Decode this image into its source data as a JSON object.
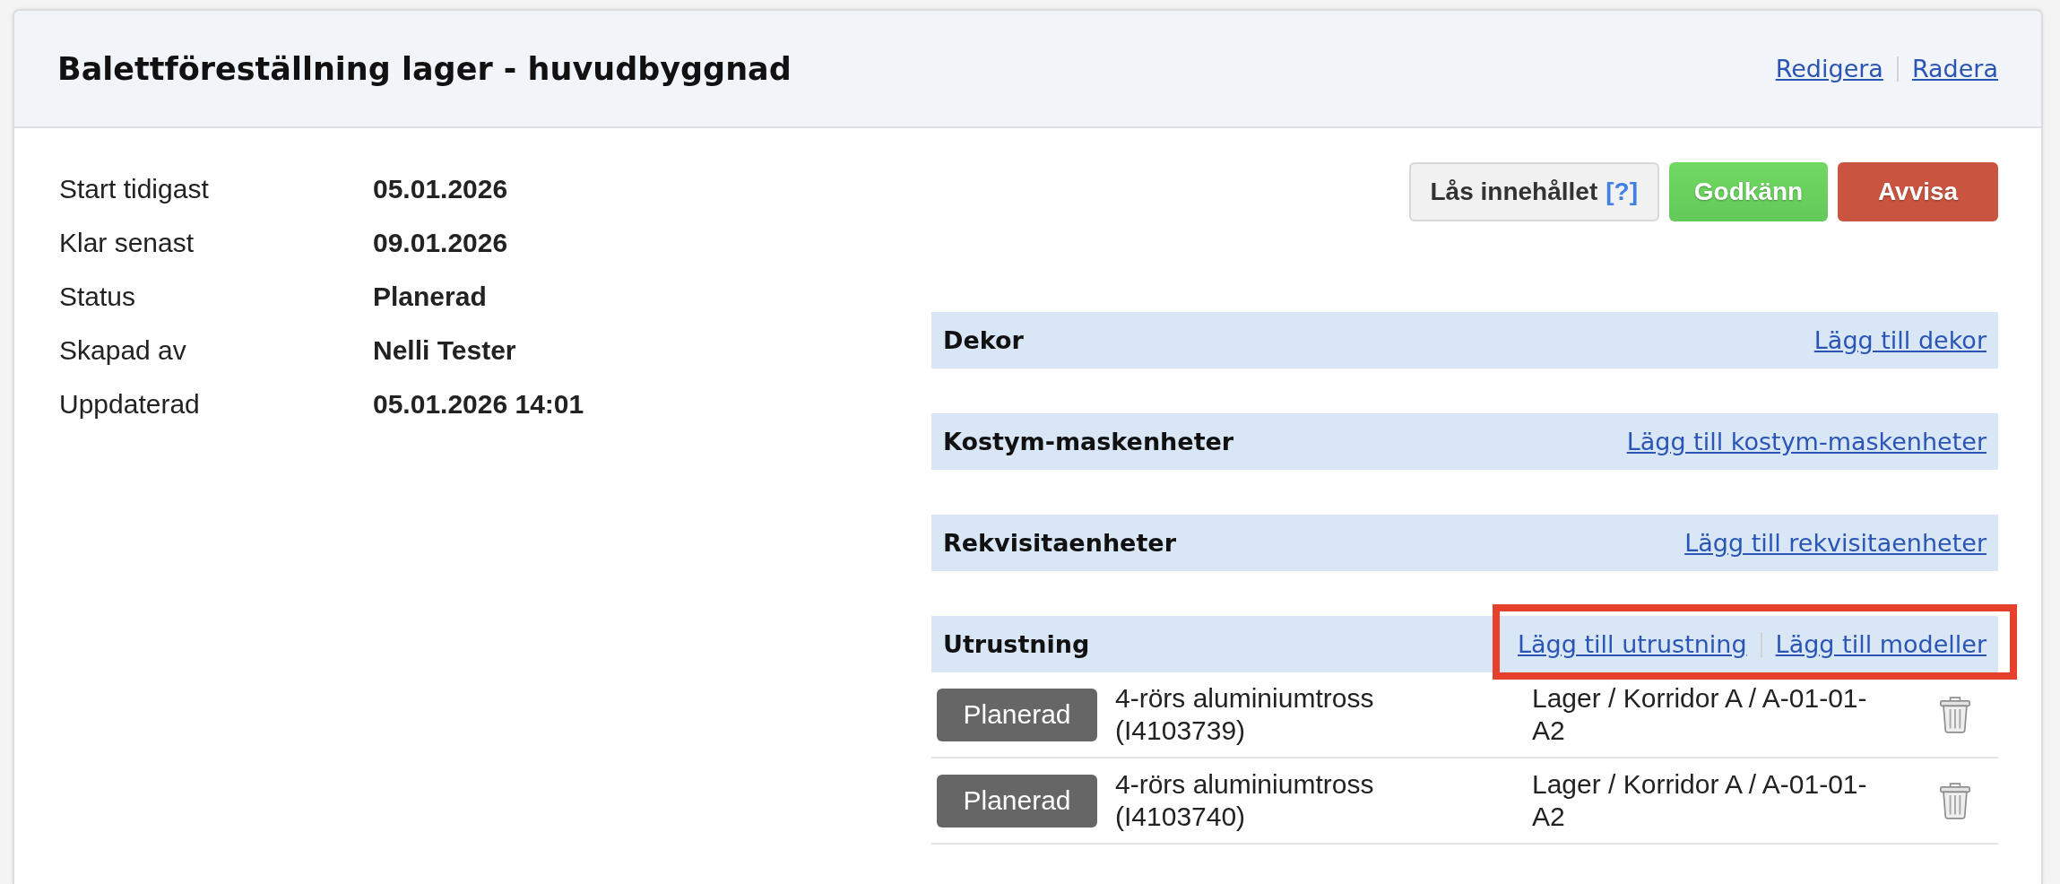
{
  "header": {
    "title": "Balettföreställning lager - huvudbyggnad",
    "actions": [
      "Redigera",
      "Radera"
    ]
  },
  "details": [
    {
      "label": "Start tidigast",
      "value": "05.01.2026"
    },
    {
      "label": "Klar senast",
      "value": "09.01.2026"
    },
    {
      "label": "Status",
      "value": "Planerad"
    },
    {
      "label": "Skapad av",
      "value": "Nelli Tester"
    },
    {
      "label": "Uppdaterad",
      "value": "05.01.2026 14:01"
    }
  ],
  "buttons": [
    {
      "kind": "lock",
      "label": "Lås innehållet",
      "help": "[?]"
    },
    {
      "kind": "approve",
      "label": "Godkänn"
    },
    {
      "kind": "reject",
      "label": "Avvisa"
    }
  ],
  "sections": [
    {
      "title": "Dekor",
      "links": [
        "Lägg till dekor"
      ],
      "highlighted": false
    },
    {
      "title": "Kostym-maskenheter",
      "links": [
        "Lägg till kostym-maskenheter"
      ],
      "highlighted": false
    },
    {
      "title": "Rekvisitaenheter",
      "links": [
        "Lägg till rekvisitaenheter"
      ],
      "highlighted": false
    },
    {
      "title": "Utrustning",
      "links": [
        "Lägg till utrustning",
        "Lägg till modeller"
      ],
      "highlighted": true,
      "items": [
        {
          "status": "Planerad",
          "name": "4-rörs aluminiumtross (I4103739)",
          "location": "Lager / Korridor A / A-01-01-A2"
        },
        {
          "status": "Planerad",
          "name": "4-rörs aluminiumtross (I4103740)",
          "location": "Lager / Korridor A / A-01-01-A2"
        }
      ]
    }
  ]
}
